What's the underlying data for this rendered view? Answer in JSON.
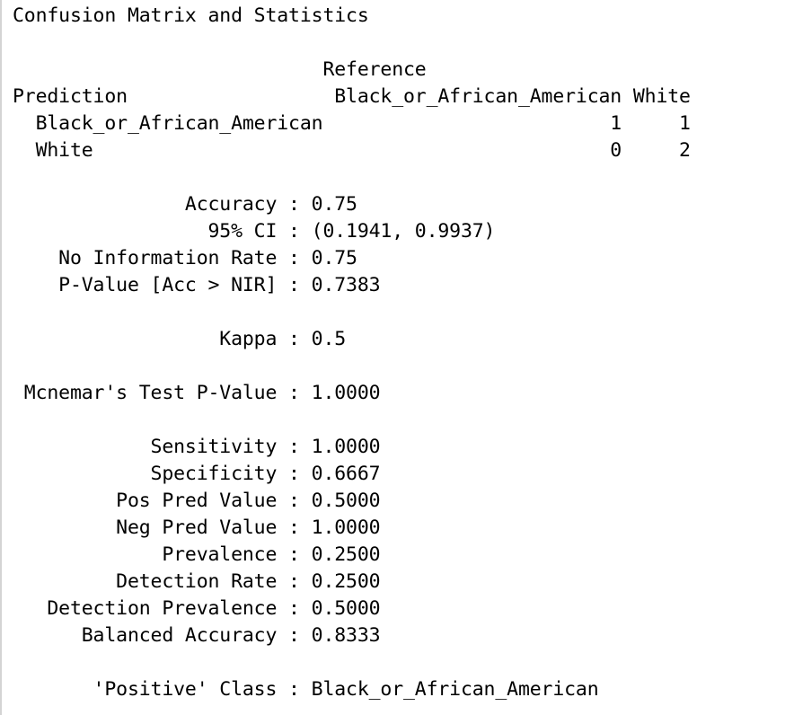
{
  "console": {
    "lines": [
      "Confusion Matrix and Statistics",
      "",
      "                           Reference",
      "Prediction                  Black_or_African_American White",
      "  Black_or_African_American                         1     1",
      "  White                                             0     2",
      "",
      "               Accuracy : 0.75",
      "                 95% CI : (0.1941, 0.9937)",
      "    No Information Rate : 0.75",
      "    P-Value [Acc > NIR] : 0.7383",
      "",
      "                  Kappa : 0.5",
      "",
      " Mcnemar's Test P-Value : 1.0000",
      "",
      "            Sensitivity : 1.0000",
      "            Specificity : 0.6667",
      "         Pos Pred Value : 0.5000",
      "         Neg Pred Value : 1.0000",
      "             Prevalence : 0.2500",
      "         Detection Rate : 0.2500",
      "   Detection Prevalence : 0.5000",
      "      Balanced Accuracy : 0.8333",
      "",
      "       'Positive' Class : Black_or_African_American"
    ]
  }
}
